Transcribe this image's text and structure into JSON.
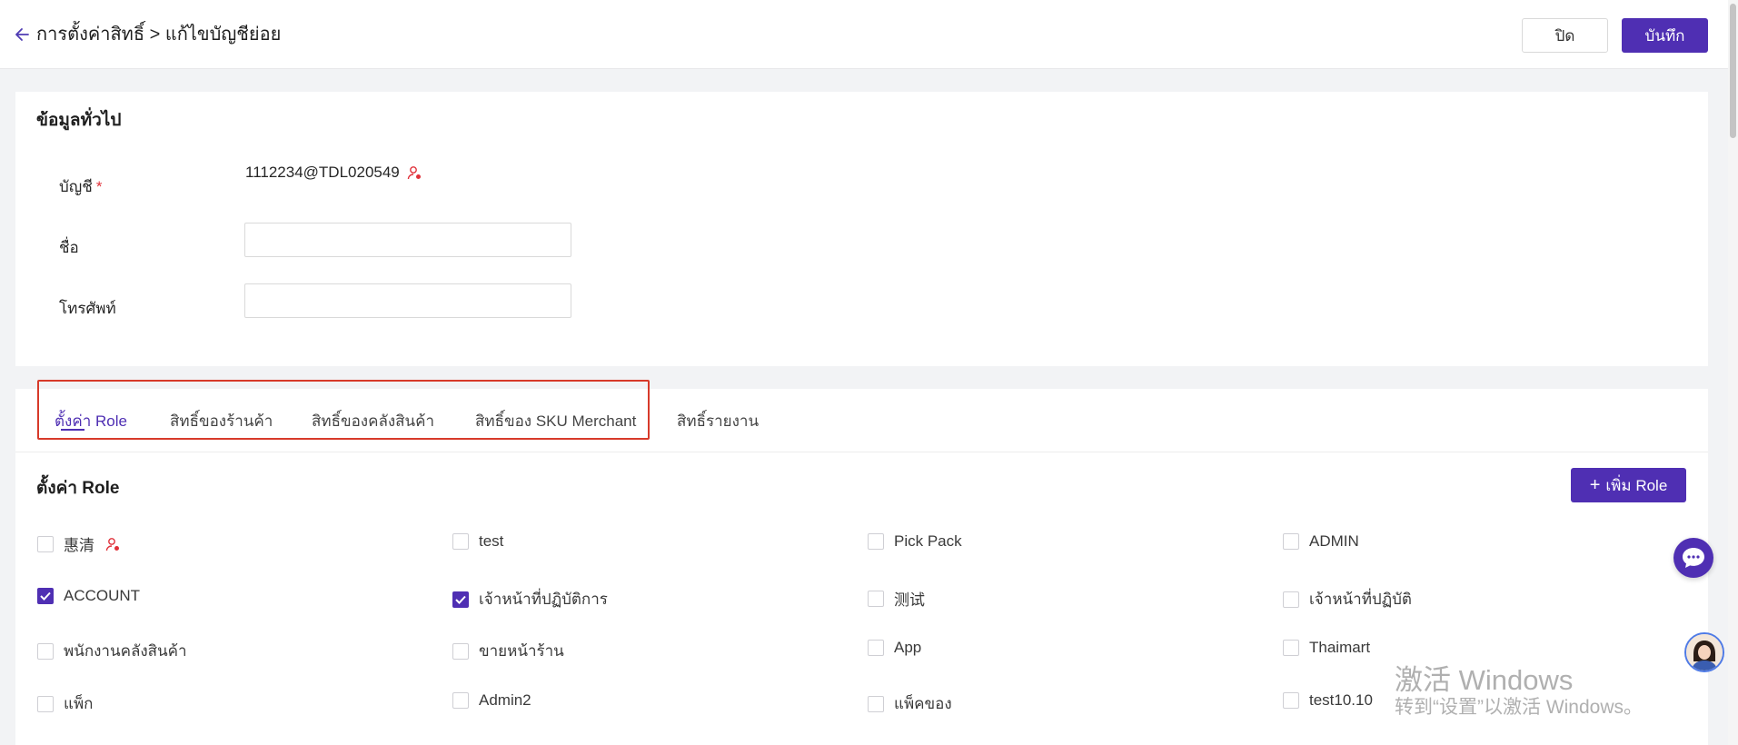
{
  "header": {
    "title": "การตั้งค่าสิทธิ์ > แก้ไขบัญชีย่อย",
    "close_label": "ปิด",
    "save_label": "บันทึก"
  },
  "general": {
    "section_title": "ข้อมูลทั่วไป",
    "account_label": "บัญชี",
    "account_required": "*",
    "account_value": "1112234@TDL020549",
    "name_label": "ชื่อ",
    "name_value": "",
    "phone_label": "โทรศัพท์",
    "phone_value": ""
  },
  "tabs": [
    {
      "label": "ตั้งค่า Role",
      "active": true
    },
    {
      "label": "สิทธิ์ของร้านค้า",
      "active": false
    },
    {
      "label": "สิทธิ์ของคลังสินค้า",
      "active": false
    },
    {
      "label": "สิทธิ์ของ SKU Merchant",
      "active": false
    },
    {
      "label": "สิทธิ์รายงาน",
      "active": false
    }
  ],
  "roles": {
    "section_title": "ตั้งค่า Role",
    "add_label": "เพิ่ม Role",
    "items": [
      {
        "label": "惠清",
        "checked": false
      },
      {
        "label": "test",
        "checked": false
      },
      {
        "label": "Pick Pack",
        "checked": false
      },
      {
        "label": "ADMIN",
        "checked": false
      },
      {
        "label": "ACCOUNT",
        "checked": true
      },
      {
        "label": "เจ้าหน้าที่ปฏิบัติการ",
        "checked": true
      },
      {
        "label": "测试",
        "checked": false
      },
      {
        "label": "เจ้าหน้าที่ปฏิบัติ",
        "checked": false
      },
      {
        "label": "พนักงานคลังสินค้า",
        "checked": false
      },
      {
        "label": "ขายหน้าร้าน",
        "checked": false
      },
      {
        "label": "App",
        "checked": false
      },
      {
        "label": "Thaimart",
        "checked": false
      },
      {
        "label": "แพ็ก",
        "checked": false
      },
      {
        "label": "Admin2",
        "checked": false
      },
      {
        "label": "แพ็คของ",
        "checked": false
      },
      {
        "label": "test10.10",
        "checked": false
      }
    ]
  },
  "watermark": {
    "line1": "激活 Windows",
    "line2": "转到“设置”以激活 Windows。"
  },
  "colors": {
    "accent": "#4f2fb3",
    "highlight_border": "#d73a2a",
    "required": "#e0313a"
  }
}
